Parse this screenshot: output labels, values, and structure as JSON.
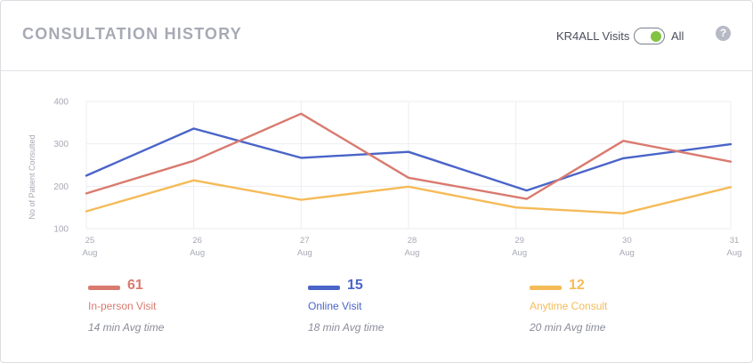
{
  "header": {
    "title": "CONSULTATION HISTORY",
    "toggle_label": "KR4ALL Visits",
    "toggle_value": "All",
    "help_symbol": "?"
  },
  "colors": {
    "in_person": "#d97a6f",
    "online": "#4a64c8",
    "anytime": "#f5bb58",
    "toggle_on": "#82c341"
  },
  "chart_data": {
    "type": "line",
    "ylabel": "No of  Patient Consulted",
    "ylim": [
      100,
      400
    ],
    "yticks": [
      100,
      200,
      300,
      400
    ],
    "categories": [
      {
        "day": "25",
        "month": "Aug"
      },
      {
        "day": "26",
        "month": "Aug"
      },
      {
        "day": "27",
        "month": "Aug"
      },
      {
        "day": "28",
        "month": "Aug"
      },
      {
        "day": "29",
        "month": "Aug"
      },
      {
        "day": "30",
        "month": "Aug"
      },
      {
        "day": "31",
        "month": "Aug"
      }
    ],
    "x_positions": [
      0,
      1,
      2,
      3,
      4,
      5,
      6
    ],
    "series": [
      {
        "name": "Online Visit",
        "color": "#4a64c8",
        "points": [
          [
            0,
            225
          ],
          [
            1,
            336
          ],
          [
            2,
            267
          ],
          [
            3,
            281
          ],
          [
            4.1,
            190
          ],
          [
            5,
            266
          ],
          [
            6,
            299
          ]
        ]
      },
      {
        "name": "In-person Visit",
        "color": "#d97a6f",
        "points": [
          [
            0,
            183
          ],
          [
            1,
            260
          ],
          [
            2,
            371
          ],
          [
            3,
            220
          ],
          [
            4.1,
            170
          ],
          [
            5,
            307
          ],
          [
            6,
            258
          ]
        ]
      },
      {
        "name": "Anytime Consult",
        "color": "#f5bb58",
        "points": [
          [
            0,
            141
          ],
          [
            1,
            214
          ],
          [
            2,
            168
          ],
          [
            3,
            199
          ],
          [
            4,
            150
          ],
          [
            5,
            136
          ],
          [
            6,
            198
          ]
        ]
      }
    ]
  },
  "legend": [
    {
      "count": "61",
      "name": "In-person Visit",
      "avg": "14 min Avg time",
      "color": "#d97a6f"
    },
    {
      "count": "15",
      "name": "Online Visit",
      "avg": "18 min Avg time",
      "color": "#4a64c8"
    },
    {
      "count": "12",
      "name": "Anytime Consult",
      "avg": "20 min Avg time",
      "color": "#f5bb58"
    }
  ]
}
